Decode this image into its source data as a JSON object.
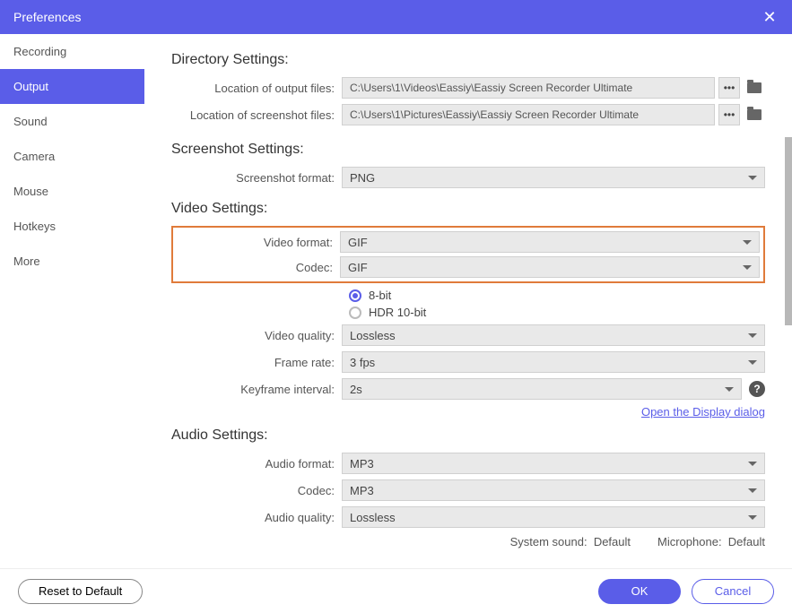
{
  "title": "Preferences",
  "sidebar": {
    "items": [
      {
        "label": "Recording"
      },
      {
        "label": "Output"
      },
      {
        "label": "Sound"
      },
      {
        "label": "Camera"
      },
      {
        "label": "Mouse"
      },
      {
        "label": "Hotkeys"
      },
      {
        "label": "More"
      }
    ],
    "active": 1
  },
  "sections": {
    "directory": {
      "title": "Directory Settings:",
      "output_label": "Location of output files:",
      "output_path": "C:\\Users\\1\\Videos\\Eassiy\\Eassiy Screen Recorder Ultimate",
      "screenshot_label": "Location of screenshot files:",
      "screenshot_path": "C:\\Users\\1\\Pictures\\Eassiy\\Eassiy Screen Recorder Ultimate"
    },
    "screenshot": {
      "title": "Screenshot Settings:",
      "format_label": "Screenshot format:",
      "format_value": "PNG"
    },
    "video": {
      "title": "Video Settings:",
      "format_label": "Video format:",
      "format_value": "GIF",
      "codec_label": "Codec:",
      "codec_value": "GIF",
      "bit8": "8-bit",
      "hdr10": "HDR 10-bit",
      "quality_label": "Video quality:",
      "quality_value": "Lossless",
      "framerate_label": "Frame rate:",
      "framerate_value": "3 fps",
      "keyframe_label": "Keyframe interval:",
      "keyframe_value": "2s",
      "display_link": "Open the Display dialog"
    },
    "audio": {
      "title": "Audio Settings:",
      "format_label": "Audio format:",
      "format_value": "MP3",
      "codec_label": "Codec:",
      "codec_value": "MP3",
      "quality_label": "Audio quality:",
      "quality_value": "Lossless",
      "system_label": "System sound:",
      "system_value": "Default",
      "mic_label": "Microphone:",
      "mic_value": "Default"
    }
  },
  "footer": {
    "reset": "Reset to Default",
    "ok": "OK",
    "cancel": "Cancel"
  }
}
